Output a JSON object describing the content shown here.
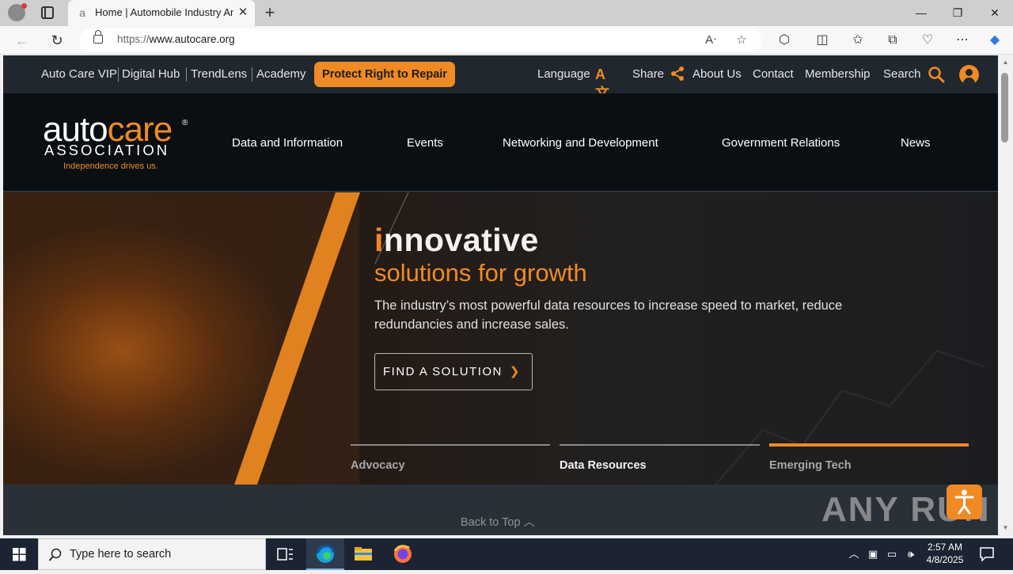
{
  "browser": {
    "tab_title": "Home | Automobile Industry An",
    "tab_close": "✕",
    "new_tab": "+",
    "url_protocol": "https://",
    "url_host": "www.autocare.org",
    "window_minimize": "—",
    "window_restore": "❐",
    "window_close": "✕"
  },
  "utility_bar": {
    "links": [
      "Auto Care VIP",
      "Digital Hub",
      "TrendLens",
      "Academy"
    ],
    "repair_button": "Protect Right to Repair",
    "language": "Language",
    "language_glyph": "A文",
    "share": "Share",
    "about": "About Us",
    "contact": "Contact",
    "membership": "Membership",
    "search": "Search"
  },
  "logo": {
    "auto": "auto",
    "care": "care",
    "registered": "®",
    "association": "ASSOCIATION",
    "tagline": "Independence drives us."
  },
  "main_nav": [
    "Data and Information",
    "Events",
    "Networking and Development",
    "Government Relations",
    "News"
  ],
  "hero": {
    "headline_first_letter": "i",
    "headline_rest": "nnovative",
    "subheadline": "solutions for growth",
    "description": "The industry’s most powerful data resources to increase speed to market, reduce redundancies and increase sales.",
    "cta": "FIND A SOLUTION",
    "cta_chevron": "❯",
    "carousel_tabs": [
      {
        "label": "Advocacy",
        "active": false
      },
      {
        "label": "Data Resources",
        "active": false
      },
      {
        "label": "Emerging Tech",
        "active": true
      }
    ]
  },
  "footer": {
    "back_to_top": "Back to Top",
    "watermark": "ANY RUN"
  },
  "taskbar": {
    "search_placeholder": "Type here to search",
    "time": "2:57 AM",
    "date": "4/8/2025"
  },
  "colors": {
    "brand_orange": "#f08a24",
    "nav_dark": "#0a0f14",
    "util_bar": "#20272e"
  }
}
